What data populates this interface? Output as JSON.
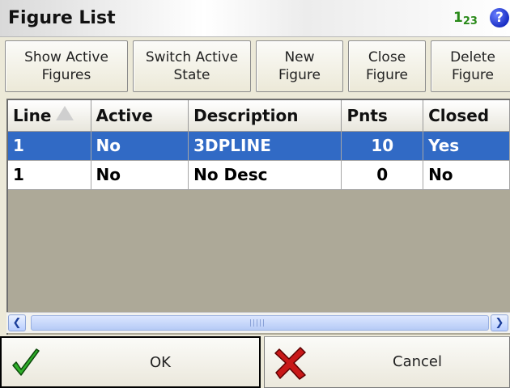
{
  "titlebar": {
    "title": "Figure List",
    "input_mode": "1",
    "input_mode_sub": "2",
    "input_mode_tail": "3",
    "help_icon": "question-icon",
    "help_text": "?"
  },
  "toolbar": {
    "buttons": [
      {
        "label": "Show Active\nFigures"
      },
      {
        "label": "Switch Active\nState"
      },
      {
        "label": "New\nFigure"
      },
      {
        "label": "Close\nFigure"
      },
      {
        "label": "Delete\nFigure"
      }
    ]
  },
  "grid": {
    "columns": [
      "Line",
      "Active",
      "Description",
      "Pnts",
      "Closed"
    ],
    "sort_column": "Line",
    "rows": [
      {
        "line": "1",
        "active": "No",
        "description": "3DPLINE",
        "pnts": "10",
        "closed": "Yes",
        "selected": true
      },
      {
        "line": "1",
        "active": "No",
        "description": "No Desc",
        "pnts": "0",
        "closed": "No",
        "selected": false
      }
    ],
    "selection_color": "#316ac5"
  },
  "footer": {
    "ok_label": "OK",
    "cancel_label": "Cancel",
    "ok_icon": "checkmark-icon",
    "cancel_icon": "x-icon"
  }
}
